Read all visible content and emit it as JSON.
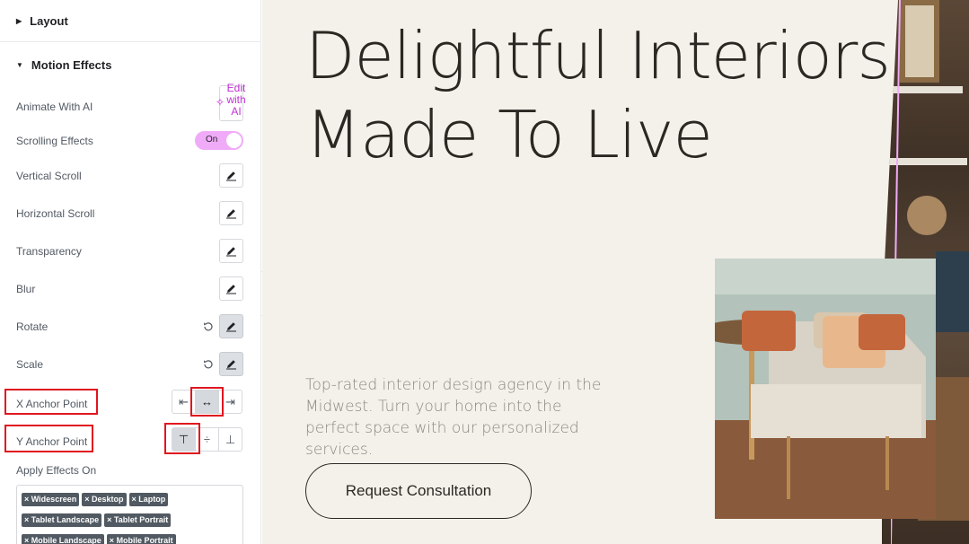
{
  "panel": {
    "sections": {
      "layout": "Layout",
      "motion_effects": "Motion Effects"
    },
    "animate_with_ai": {
      "label": "Animate With AI",
      "button": "Edit with AI"
    },
    "scrolling_effects": {
      "label": "Scrolling Effects",
      "toggle": "On"
    },
    "rows": {
      "vertical_scroll": "Vertical Scroll",
      "horizontal_scroll": "Horizontal Scroll",
      "transparency": "Transparency",
      "blur": "Blur",
      "rotate": "Rotate",
      "scale": "Scale"
    },
    "x_anchor": {
      "label": "X Anchor Point",
      "options": [
        "left-align-icon",
        "center-align-icon",
        "right-align-icon"
      ],
      "selected": "center"
    },
    "y_anchor": {
      "label": "Y Anchor Point",
      "options": [
        "top-align-icon",
        "middle-align-icon",
        "bottom-align-icon"
      ],
      "selected": "top"
    },
    "apply_effects_on": {
      "label": "Apply Effects On",
      "tags": [
        "Widescreen",
        "Desktop",
        "Laptop",
        "Tablet Landscape",
        "Tablet Portrait",
        "Mobile Landscape",
        "Mobile Portrait"
      ]
    }
  },
  "canvas": {
    "headline": [
      "Delightful Interiors",
      "Made To Live"
    ],
    "body": "Top-rated interior design agency in the Midwest. Turn your home into the perfect space with our personalized services.",
    "cta": "Request Consultation"
  },
  "colors": {
    "accent": "#f0abf8",
    "ai_accent": "#c32fd6",
    "highlight": "#e0161f",
    "canvas_bg": "#f4f1ea"
  }
}
